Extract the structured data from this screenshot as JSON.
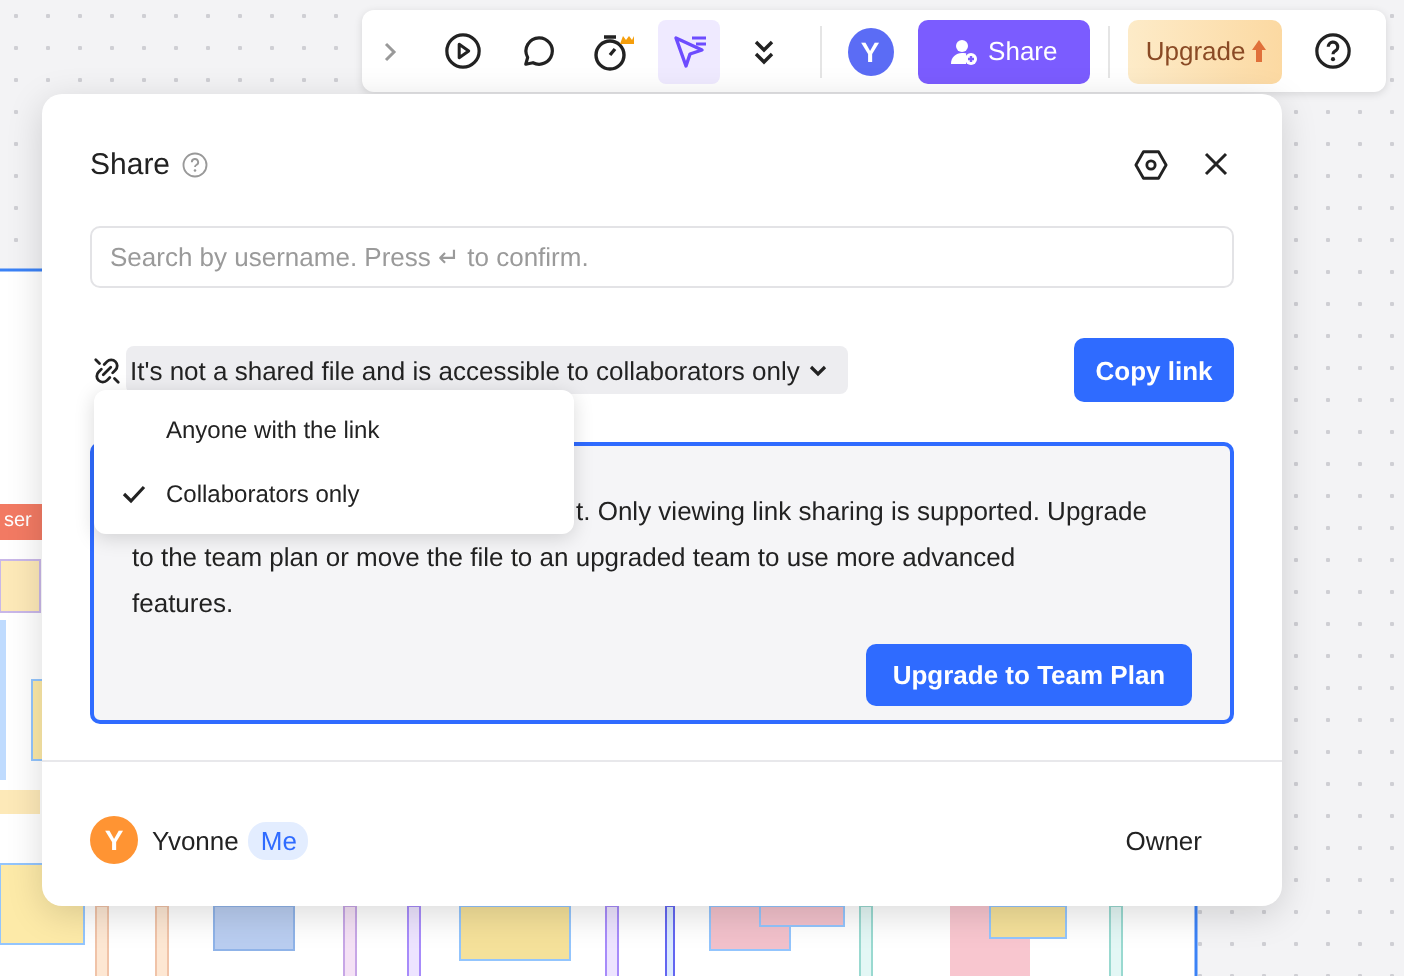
{
  "canvas": {
    "tag": "ser"
  },
  "toolbar": {
    "tools": [
      {
        "kind": "expand",
        "selected": false
      },
      {
        "kind": "play",
        "selected": false
      },
      {
        "kind": "comment",
        "selected": false
      },
      {
        "kind": "timer",
        "selected": false
      },
      {
        "kind": "laser",
        "selected": true
      },
      {
        "kind": "more",
        "selected": false
      }
    ],
    "avatar": "Y",
    "share_button": "Share",
    "upgrade_button": "Upgrade"
  },
  "dialog": {
    "title": "Share",
    "search": {
      "placeholder": "Search by username. Press ↵ to confirm."
    },
    "link_access": "It's not a shared file and is accessible to collaborators only",
    "copy_button": "Copy link",
    "access_options": [
      {
        "label": "Anyone with the link",
        "selected": false
      },
      {
        "label": "Collaborators only",
        "selected": true
      }
    ],
    "notice_lines": [
      "t. Only viewing link sharing is supported. Upgrade",
      "to the team plan or move the file to an upgraded team to use more advanced",
      "features."
    ],
    "notice_button": "Upgrade to Team Plan",
    "members": [
      {
        "initial": "Y",
        "name": "Yvonne",
        "badge": "Me",
        "role": "Owner"
      }
    ]
  }
}
